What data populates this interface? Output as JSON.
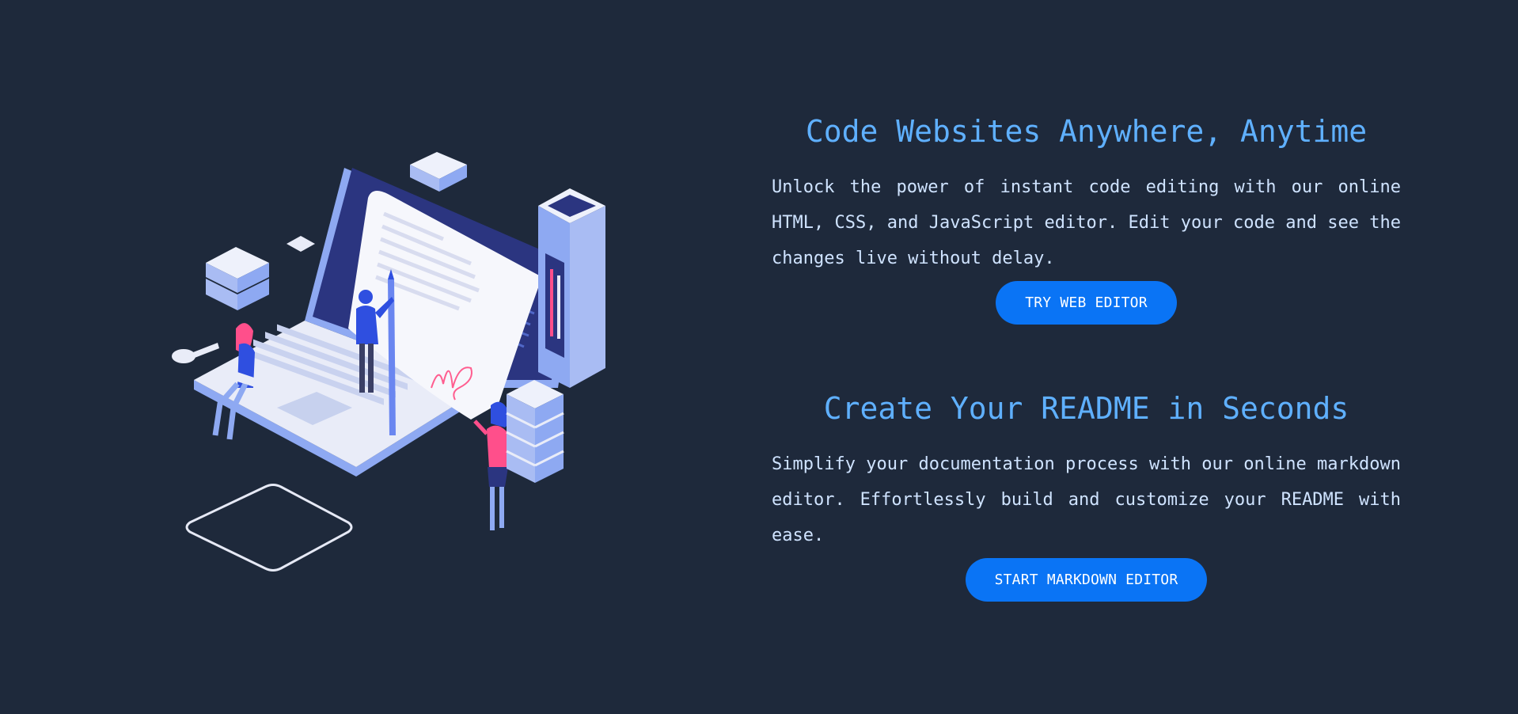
{
  "illustration": {
    "icon": "isometric-laptop-document-signing-illustration",
    "colors": {
      "background": "#1e293b",
      "laptop_light": "#e9ecf8",
      "laptop_blue": "#8ea9f2",
      "screen_dark": "#2b3580",
      "person_blue": "#2f4fe0",
      "person_pink": "#ff4f8b",
      "signature": "#ff5d8f"
    }
  },
  "sections": [
    {
      "title": "Code Websites Anywhere, Anytime",
      "description": "Unlock the power of instant code editing with our online HTML, CSS, and JavaScript editor. Edit your code and see the changes live without delay.",
      "button_label": "TRY WEB EDITOR"
    },
    {
      "title": "Create Your README in Seconds",
      "description": "Simplify your documentation process with our online markdown editor. Effortlessly build and customize your README with ease.",
      "button_label": "START MARKDOWN EDITOR"
    }
  ],
  "colors": {
    "background": "#1e293b",
    "heading": "#5fb0ff",
    "body_text": "#cfe3ff",
    "button": "#0a74f5",
    "button_text": "#ffffff"
  }
}
